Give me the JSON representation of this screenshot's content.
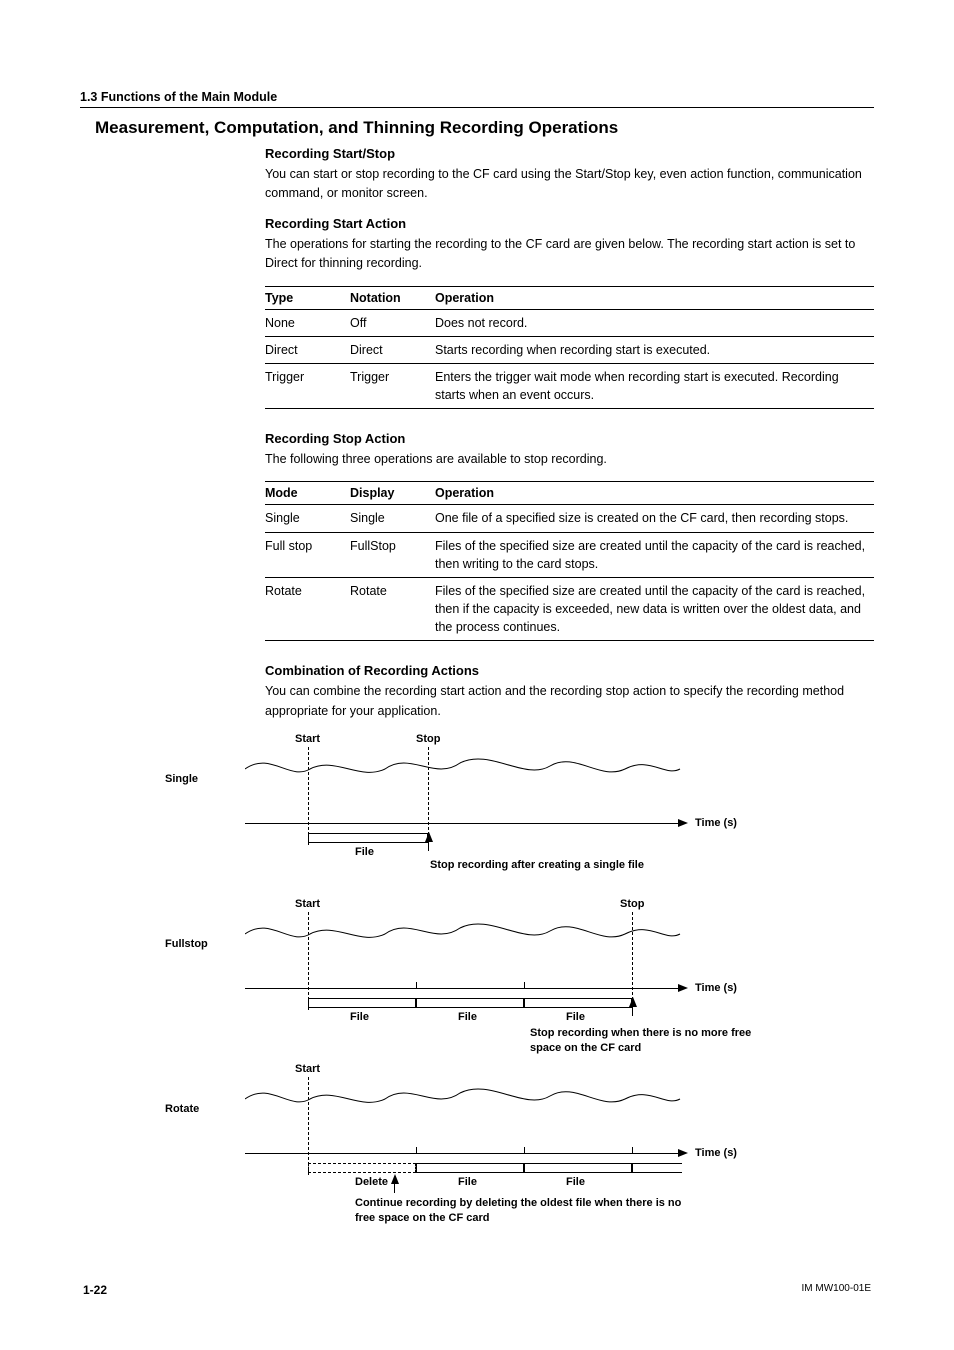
{
  "header": {
    "section": "1.3  Functions of the Main Module"
  },
  "title": "Measurement, Computation, and Thinning Recording Operations",
  "s1": {
    "h": "Recording Start/Stop",
    "p": "You can start or stop recording to the CF card using the Start/Stop key, even action function, communication command, or monitor screen."
  },
  "s2": {
    "h": "Recording Start Action",
    "p": "The operations for starting the recording to the CF card are given below. The recording start action is set to Direct for thinning recording.",
    "th": {
      "a": "Type",
      "b": "Notation",
      "c": "Operation"
    },
    "rows": [
      {
        "a": "None",
        "b": "Off",
        "c": "Does not record."
      },
      {
        "a": "Direct",
        "b": "Direct",
        "c": "Starts recording when recording start is executed."
      },
      {
        "a": "Trigger",
        "b": "Trigger",
        "c": "Enters the trigger wait mode when recording start is executed. Recording starts when an event occurs."
      }
    ]
  },
  "s3": {
    "h": "Recording Stop Action",
    "p": "The following three operations are available to stop recording.",
    "th": {
      "a": "Mode",
      "b": "Display",
      "c": "Operation"
    },
    "rows": [
      {
        "a": "Single",
        "b": "Single",
        "c": "One file of a specified size is created on the CF card, then recording stops."
      },
      {
        "a": "Full stop",
        "b": "FullStop",
        "c": "Files of the specified size are created until the capacity of the card is reached, then writing to the card stops."
      },
      {
        "a": "Rotate",
        "b": "Rotate",
        "c": "Files of the specified size are created until the capacity of the card is reached, then if the capacity is exceeded, new data is written over the oldest data, and the process continues."
      }
    ]
  },
  "s4": {
    "h": "Combination of Recording Actions",
    "p": "You can combine the recording start action and the recording stop action to specify the recording method appropriate for your application."
  },
  "dia": {
    "single": {
      "label": "Single",
      "start": "Start",
      "stop": "Stop",
      "file": "File",
      "time": "Time (s)",
      "caption": "Stop recording after creating a single file"
    },
    "fullstop": {
      "label": "Fullstop",
      "start": "Start",
      "stop": "Stop",
      "file": "File",
      "time": "Time (s)",
      "caption": "Stop recording when there is no more free space on the CF card"
    },
    "rotate": {
      "label": "Rotate",
      "start": "Start",
      "delete": "Delete",
      "file": "File",
      "time": "Time (s)",
      "caption": "Continue recording by deleting the oldest file when there is no free space on the CF card"
    }
  },
  "footer": {
    "page": "1-22",
    "doc": "IM MW100-01E"
  }
}
